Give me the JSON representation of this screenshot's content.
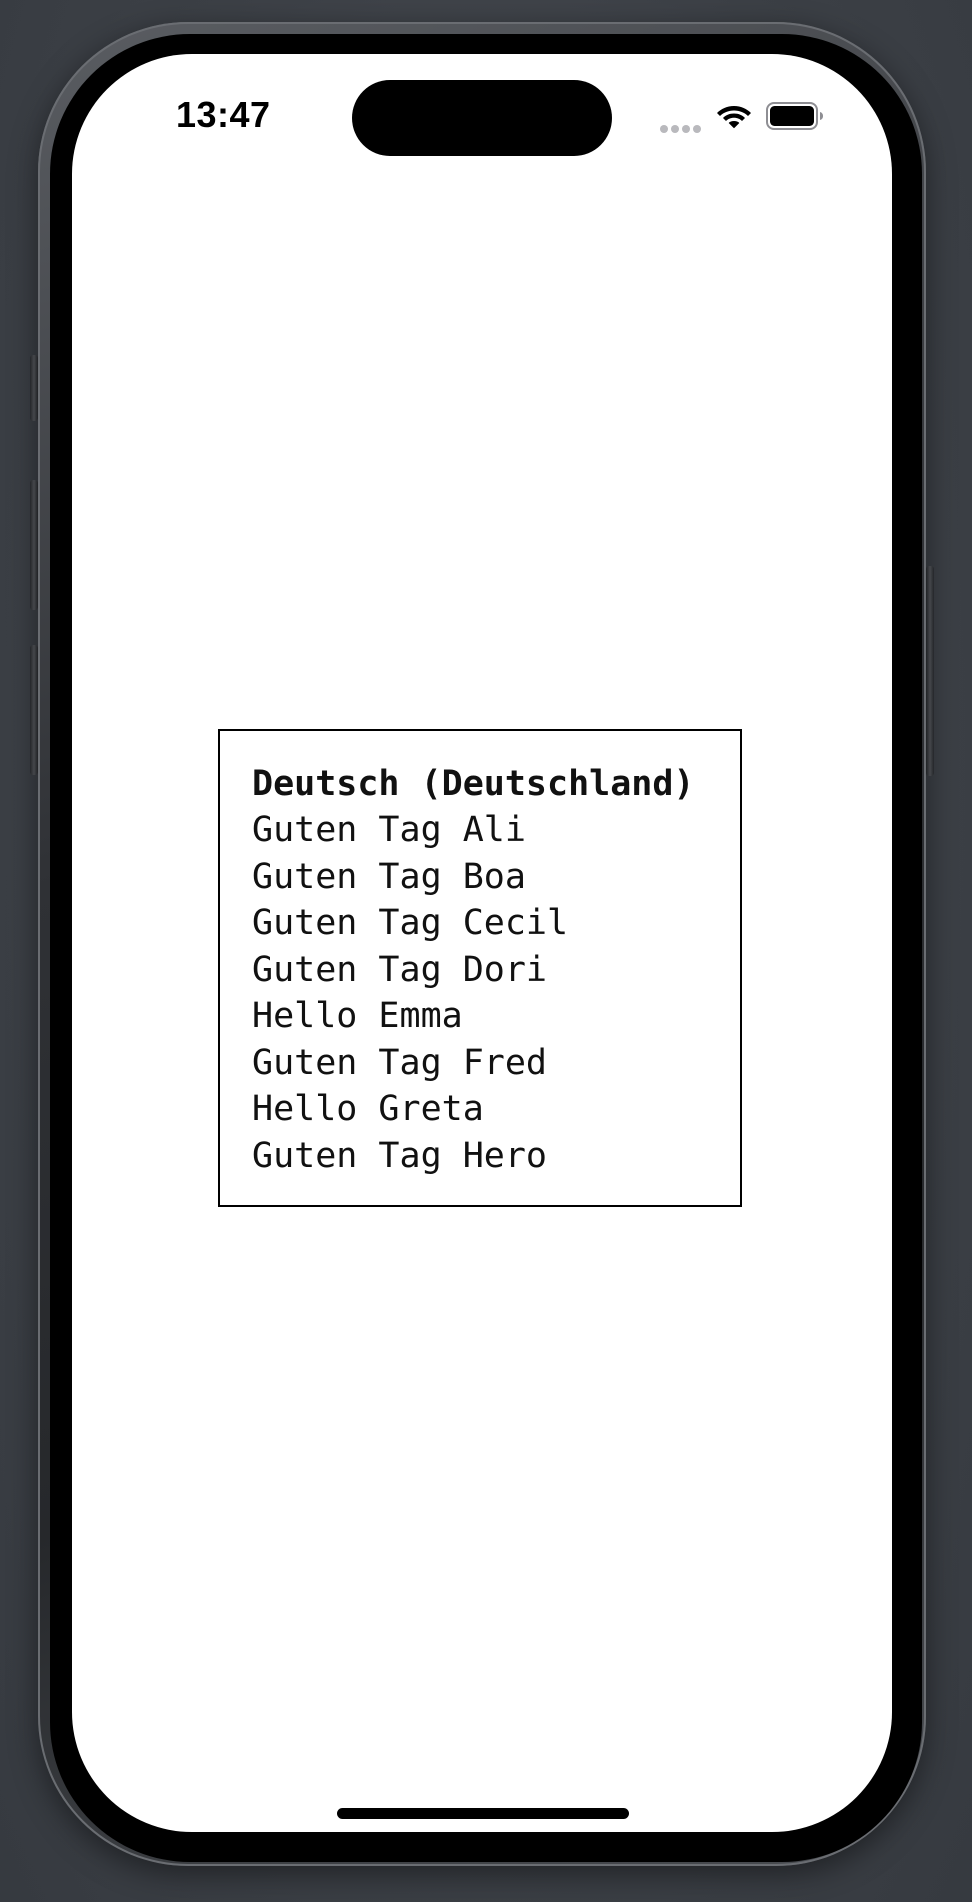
{
  "status_bar": {
    "time": "13:47",
    "signal_icon": "cellular-dots-icon",
    "wifi_icon": "wifi-icon",
    "battery_icon": "battery-icon"
  },
  "card": {
    "title": "Deutsch (Deutschland)",
    "greetings": [
      "Guten Tag Ali",
      "Guten Tag Boa",
      "Guten Tag Cecil",
      "Guten Tag Dori",
      "Hello Emma",
      "Guten Tag Fred",
      "Hello Greta",
      "Guten Tag Hero"
    ]
  },
  "colors": {
    "screen_background": "#ffffff",
    "text": "#111111",
    "border": "#000000"
  }
}
